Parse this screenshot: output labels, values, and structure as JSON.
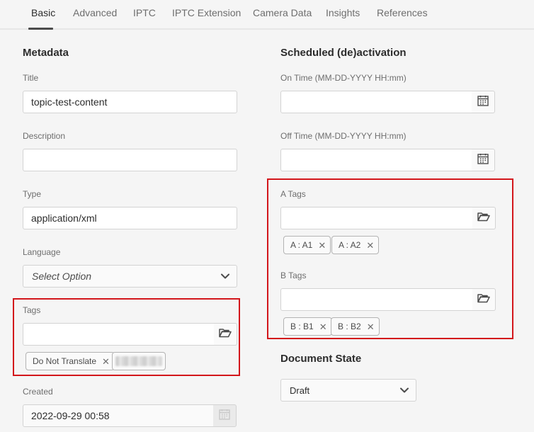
{
  "tabs": [
    {
      "label": "Basic",
      "active": true
    },
    {
      "label": "Advanced"
    },
    {
      "label": "IPTC"
    },
    {
      "label": "IPTC Extension"
    },
    {
      "label": "Camera Data"
    },
    {
      "label": "Insights"
    },
    {
      "label": "References"
    }
  ],
  "metadata": {
    "heading": "Metadata",
    "title": {
      "label": "Title",
      "value": "topic-test-content"
    },
    "description": {
      "label": "Description",
      "value": ""
    },
    "type": {
      "label": "Type",
      "value": "application/xml"
    },
    "language": {
      "label": "Language",
      "placeholder": "Select Option"
    },
    "tags": {
      "label": "Tags",
      "value": "",
      "chips": [
        {
          "label": "Do Not Translate"
        }
      ],
      "redacted_chip": "blurred"
    },
    "created": {
      "label": "Created",
      "value": "2022-09-29 00:58"
    }
  },
  "scheduled": {
    "heading": "Scheduled (de)activation",
    "on_time": {
      "label": "On Time (MM-DD-YYYY HH:mm)",
      "value": ""
    },
    "off_time": {
      "label": "Off Time (MM-DD-YYYY HH:mm)",
      "value": ""
    },
    "a_tags": {
      "label": "A Tags",
      "value": "",
      "chips": [
        {
          "label": "A : A1"
        },
        {
          "label": "A : A2"
        }
      ]
    },
    "b_tags": {
      "label": "B Tags",
      "value": "",
      "chips": [
        {
          "label": "B : B1"
        },
        {
          "label": "B : B2"
        }
      ]
    }
  },
  "document_state": {
    "heading": "Document State",
    "value": "Draft"
  },
  "remove_glyph": "✕",
  "icons": {
    "calendar": "calendar-icon",
    "folder": "folder-icon",
    "chevron": "chevron-down-icon",
    "remove": "close-icon"
  },
  "colors": {
    "highlight_box": "#d3161b",
    "background": "#f5f5f5",
    "field_border": "#d3d3d3"
  }
}
